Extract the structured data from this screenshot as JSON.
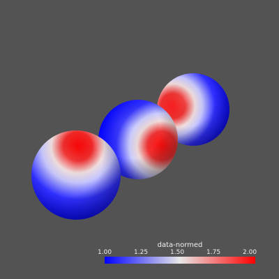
{
  "scene": {
    "background": "#535353",
    "object_count": 3,
    "object_shape": "sphere"
  },
  "colormap": {
    "low_color": "#0000ff",
    "mid_color": "#e8e8e8",
    "high_color": "#ff0000"
  },
  "scalar_bar": {
    "title": "data-normed",
    "ticks": [
      "1.00",
      "1.25",
      "1.50",
      "1.75",
      "2.00"
    ]
  }
}
